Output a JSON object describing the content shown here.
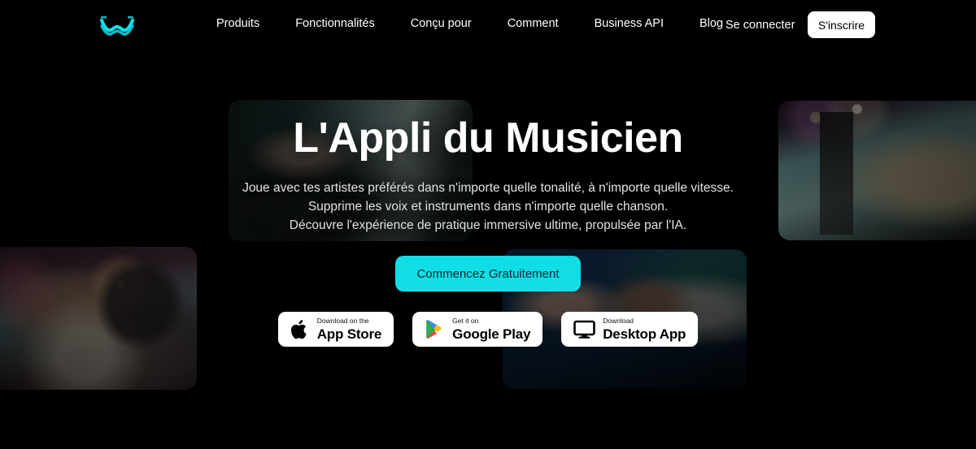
{
  "brand": {
    "logo_icon": "wave-logo-icon",
    "accent_color": "#11dde6"
  },
  "header": {
    "nav_items": [
      {
        "label": "Produits",
        "name": "nav-produits"
      },
      {
        "label": "Fonctionnalités",
        "name": "nav-fonctionnalites"
      },
      {
        "label": "Conçu pour",
        "name": "nav-concu-pour"
      },
      {
        "label": "Comment",
        "name": "nav-comment"
      },
      {
        "label": "Business API",
        "name": "nav-business-api"
      },
      {
        "label": "Blog",
        "name": "nav-blog"
      }
    ],
    "login_label": "Se connecter",
    "signup_label": "S'inscrire"
  },
  "hero": {
    "title": "L'Appli du Musicien",
    "subtitle_line_1": "Joue avec tes artistes préférés dans n'importe quelle tonalité, à n'importe quelle vitesse.",
    "subtitle_line_2": "Supprime les voix et instruments dans n'importe quelle chanson.",
    "subtitle_line_3": "Découvre l'expérience de pratique immersive ultime, propulsée par l'IA.",
    "cta_label": "Commencez Gratuitement"
  },
  "badges": [
    {
      "small": "Download on the",
      "big": "App Store",
      "icon": "apple-icon",
      "name": "badge-app-store"
    },
    {
      "small": "Get it on",
      "big": "Google Play",
      "icon": "google-play-icon",
      "name": "badge-google-play"
    },
    {
      "small": "Download",
      "big": "Desktop App",
      "icon": "monitor-icon",
      "name": "badge-desktop-app"
    }
  ],
  "background_photos": [
    {
      "name": "photo-singer-microphone",
      "alt": "singer at microphone"
    },
    {
      "name": "photo-drummer",
      "alt": "drummer playing drums"
    },
    {
      "name": "photo-guitarist",
      "alt": "guitarist with microphone stand"
    },
    {
      "name": "photo-duo-guitar",
      "alt": "two musicians with acoustic guitar"
    }
  ]
}
